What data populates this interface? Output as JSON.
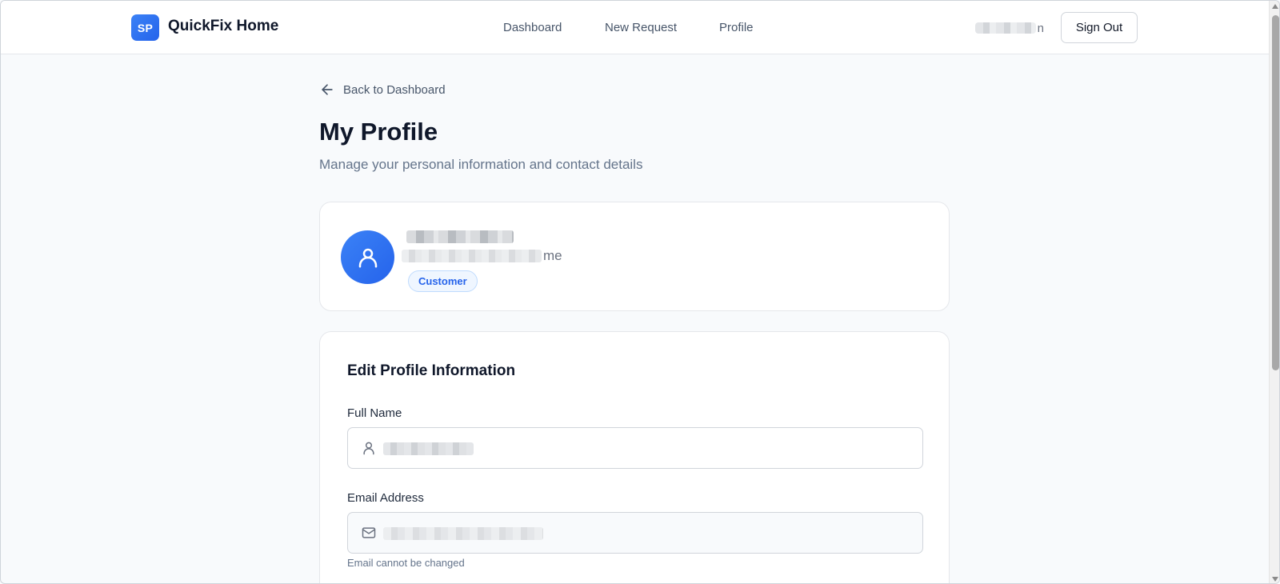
{
  "app": {
    "logo_initials": "SP",
    "name": "QuickFix Home"
  },
  "nav": {
    "items": [
      {
        "label": "Dashboard"
      },
      {
        "label": "New Request"
      },
      {
        "label": "Profile"
      }
    ]
  },
  "user_menu": {
    "name_visible_suffix": "n",
    "sign_out_label": "Sign Out"
  },
  "page": {
    "back_label": "Back to Dashboard",
    "title": "My Profile",
    "subtitle": "Manage your personal information and contact details"
  },
  "profile_card": {
    "email_visible_suffix": "me",
    "role": "Customer"
  },
  "edit_form": {
    "title": "Edit Profile Information",
    "full_name_label": "Full Name",
    "email_label": "Email Address",
    "email_help": "Email cannot be changed"
  },
  "colors": {
    "primary": "#2563eb",
    "background": "#f8fafc",
    "card": "#ffffff",
    "badge_bg": "#eff6ff"
  },
  "icons": {
    "back": "arrow-left-icon",
    "avatar": "user-icon",
    "name_field": "user-icon",
    "email_field": "mail-icon"
  }
}
